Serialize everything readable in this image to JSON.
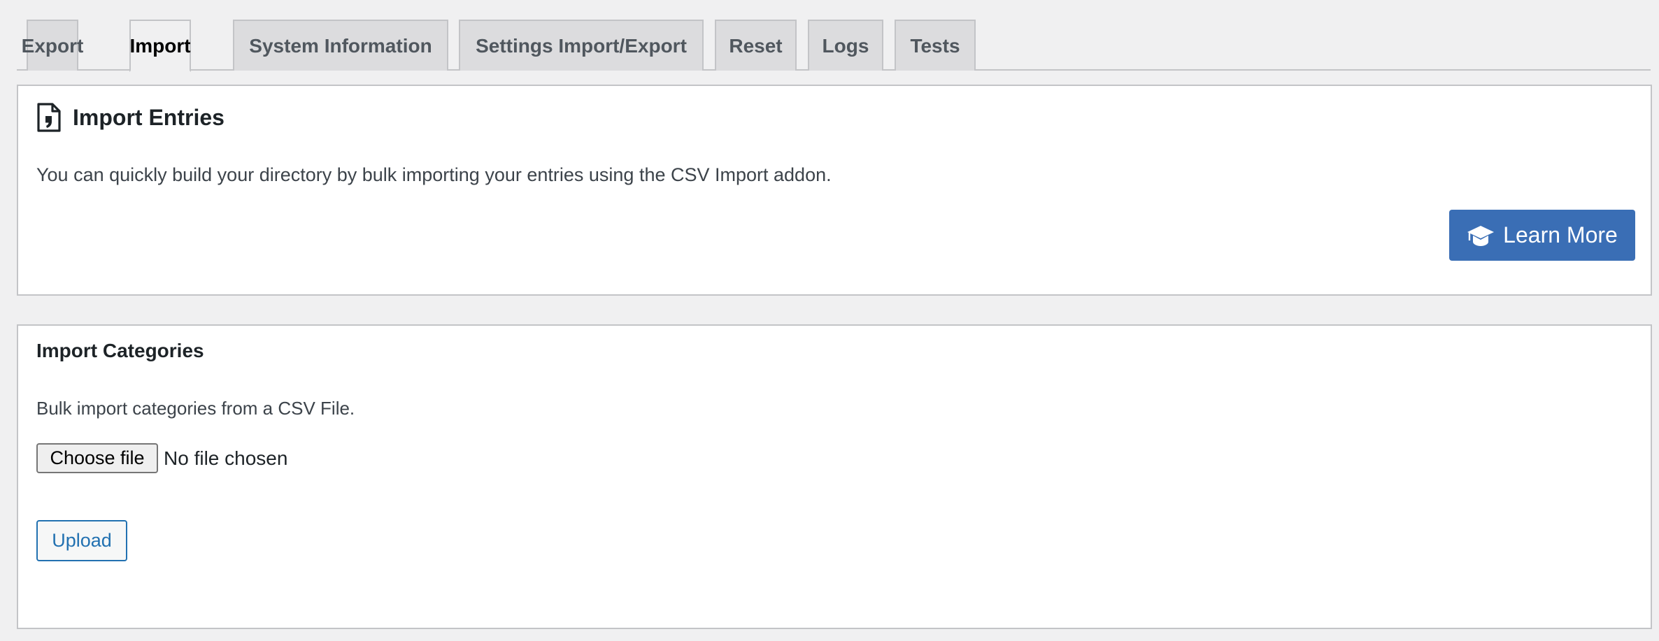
{
  "tabs": [
    {
      "label": "Export",
      "active": false
    },
    {
      "label": "Import",
      "active": true
    },
    {
      "label": "System Information",
      "active": false
    },
    {
      "label": "Settings Import/Export",
      "active": false
    },
    {
      "label": "Reset",
      "active": false
    },
    {
      "label": "Logs",
      "active": false
    },
    {
      "label": "Tests",
      "active": false
    }
  ],
  "import_entries": {
    "icon": "document-quote-icon",
    "title": "Import Entries",
    "description": "You can quickly build your directory by bulk importing your entries using the CSV Import addon.",
    "learn_more": {
      "icon": "graduation-cap-icon",
      "label": "Learn More"
    }
  },
  "import_categories": {
    "title": "Import Categories",
    "description": "Bulk import categories from a CSV File.",
    "file_input": {
      "button_label": "Choose file",
      "status": "No file chosen"
    },
    "upload_label": "Upload"
  },
  "colors": {
    "page_background": "#f0f0f1",
    "tab_inactive": "#dcdcde",
    "border": "#c3c4c7",
    "learn_more_button": "#3a6eb5",
    "upload_accent": "#2271b1"
  }
}
